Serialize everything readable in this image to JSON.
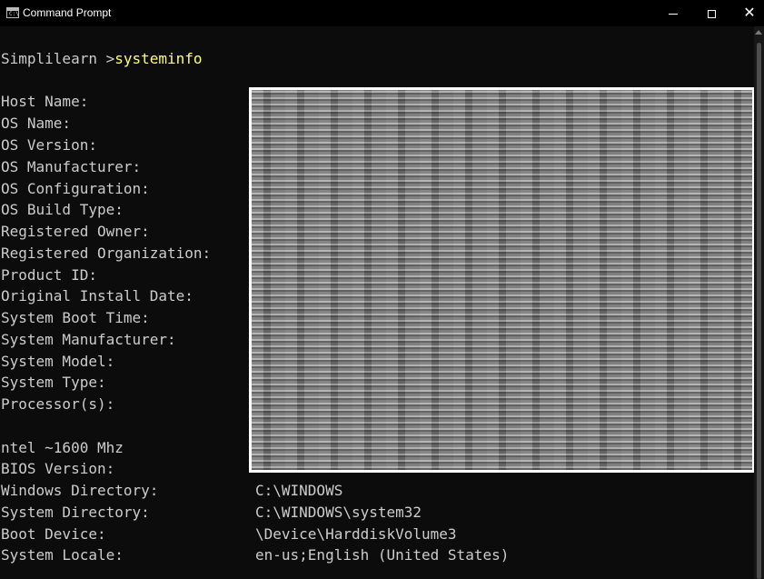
{
  "window": {
    "title": "Command Prompt",
    "icon": "cmd-icon",
    "icon_text": "C:\\",
    "min_glyph": "minimize-icon",
    "max_glyph": "maximize-icon",
    "close_glyph": "✕"
  },
  "console": {
    "prompt": "Simplilearn >",
    "command": "systeminfo",
    "lines": [
      {
        "label": "Host Name:",
        "value": ""
      },
      {
        "label": "OS Name:",
        "value": ""
      },
      {
        "label": "OS Version:",
        "value": ""
      },
      {
        "label": "OS Manufacturer:",
        "value": ""
      },
      {
        "label": "OS Configuration:",
        "value": ""
      },
      {
        "label": "OS Build Type:",
        "value": ""
      },
      {
        "label": "Registered Owner:",
        "value": ""
      },
      {
        "label": "Registered Organization:",
        "value": ""
      },
      {
        "label": "Product ID:",
        "value": ""
      },
      {
        "label": "Original Install Date:",
        "value": ""
      },
      {
        "label": "System Boot Time:",
        "value": ""
      },
      {
        "label": "System Manufacturer:",
        "value": ""
      },
      {
        "label": "System Model:",
        "value": ""
      },
      {
        "label": "System Type:",
        "value": ""
      },
      {
        "label": "Processor(s):",
        "value": ""
      },
      {
        "label": "",
        "value": ""
      },
      {
        "label": "ntel ~1600 Mhz",
        "value": ""
      },
      {
        "label": "BIOS Version:",
        "value": ""
      },
      {
        "label": "Windows Directory:",
        "value": "C:\\WINDOWS"
      },
      {
        "label": "System Directory:",
        "value": "C:\\WINDOWS\\system32"
      },
      {
        "label": "Boot Device:",
        "value": "\\Device\\HarddiskVolume3"
      },
      {
        "label": "System Locale:",
        "value": "en-us;English (United States)"
      }
    ]
  },
  "colors": {
    "background": "#0c0c0c",
    "text": "#cccccc",
    "command": "#ffff6e"
  }
}
